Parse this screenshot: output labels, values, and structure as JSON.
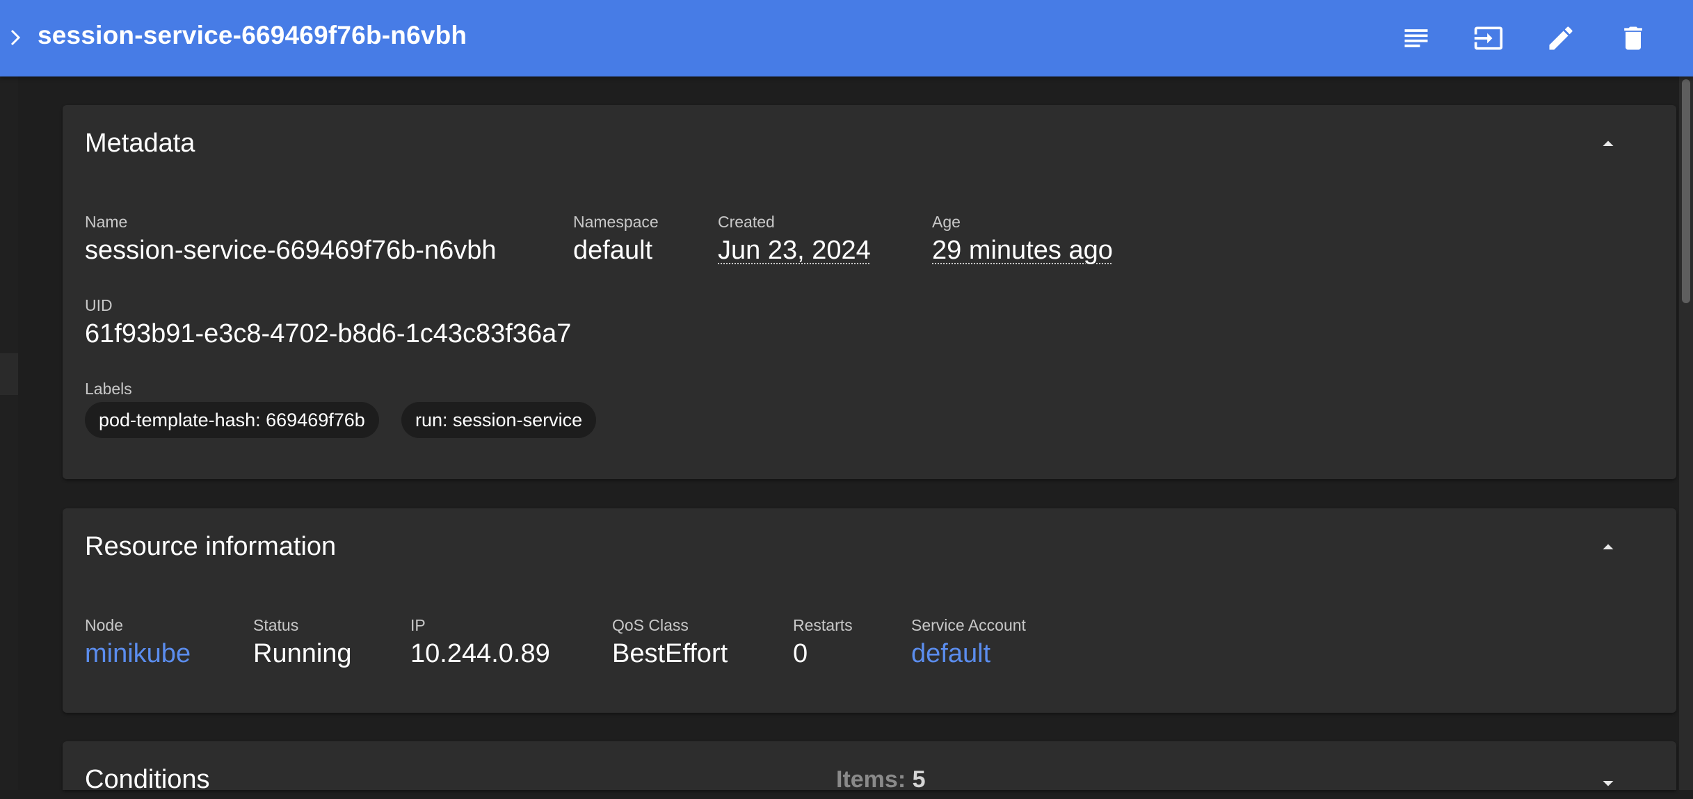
{
  "toolbar": {
    "title": "session-service-669469f76b-n6vbh",
    "background": "#477ce6",
    "actions": [
      {
        "name": "logs-icon"
      },
      {
        "name": "exec-icon"
      },
      {
        "name": "edit-icon"
      },
      {
        "name": "delete-icon"
      }
    ]
  },
  "metadata": {
    "title": "Metadata",
    "name_label": "Name",
    "name_value": "session-service-669469f76b-n6vbh",
    "namespace_label": "Namespace",
    "namespace_value": "default",
    "created_label": "Created",
    "created_value": "Jun 23, 2024",
    "age_label": "Age",
    "age_value": "29 minutes ago",
    "uid_label": "UID",
    "uid_value": "61f93b91-e3c8-4702-b8d6-1c43c83f36a7",
    "labels_label": "Labels",
    "labels": [
      "pod-template-hash: 669469f76b",
      "run: session-service"
    ]
  },
  "resource": {
    "title": "Resource information",
    "node_label": "Node",
    "node_value": "minikube",
    "status_label": "Status",
    "status_value": "Running",
    "ip_label": "IP",
    "ip_value": "10.244.0.89",
    "qos_label": "QoS Class",
    "qos_value": "BestEffort",
    "restarts_label": "Restarts",
    "restarts_value": "0",
    "sa_label": "Service Account",
    "sa_value": "default",
    "link_color": "#5b8dee"
  },
  "conditions": {
    "title": "Conditions",
    "items_label": "Items:",
    "items_count": "5"
  }
}
